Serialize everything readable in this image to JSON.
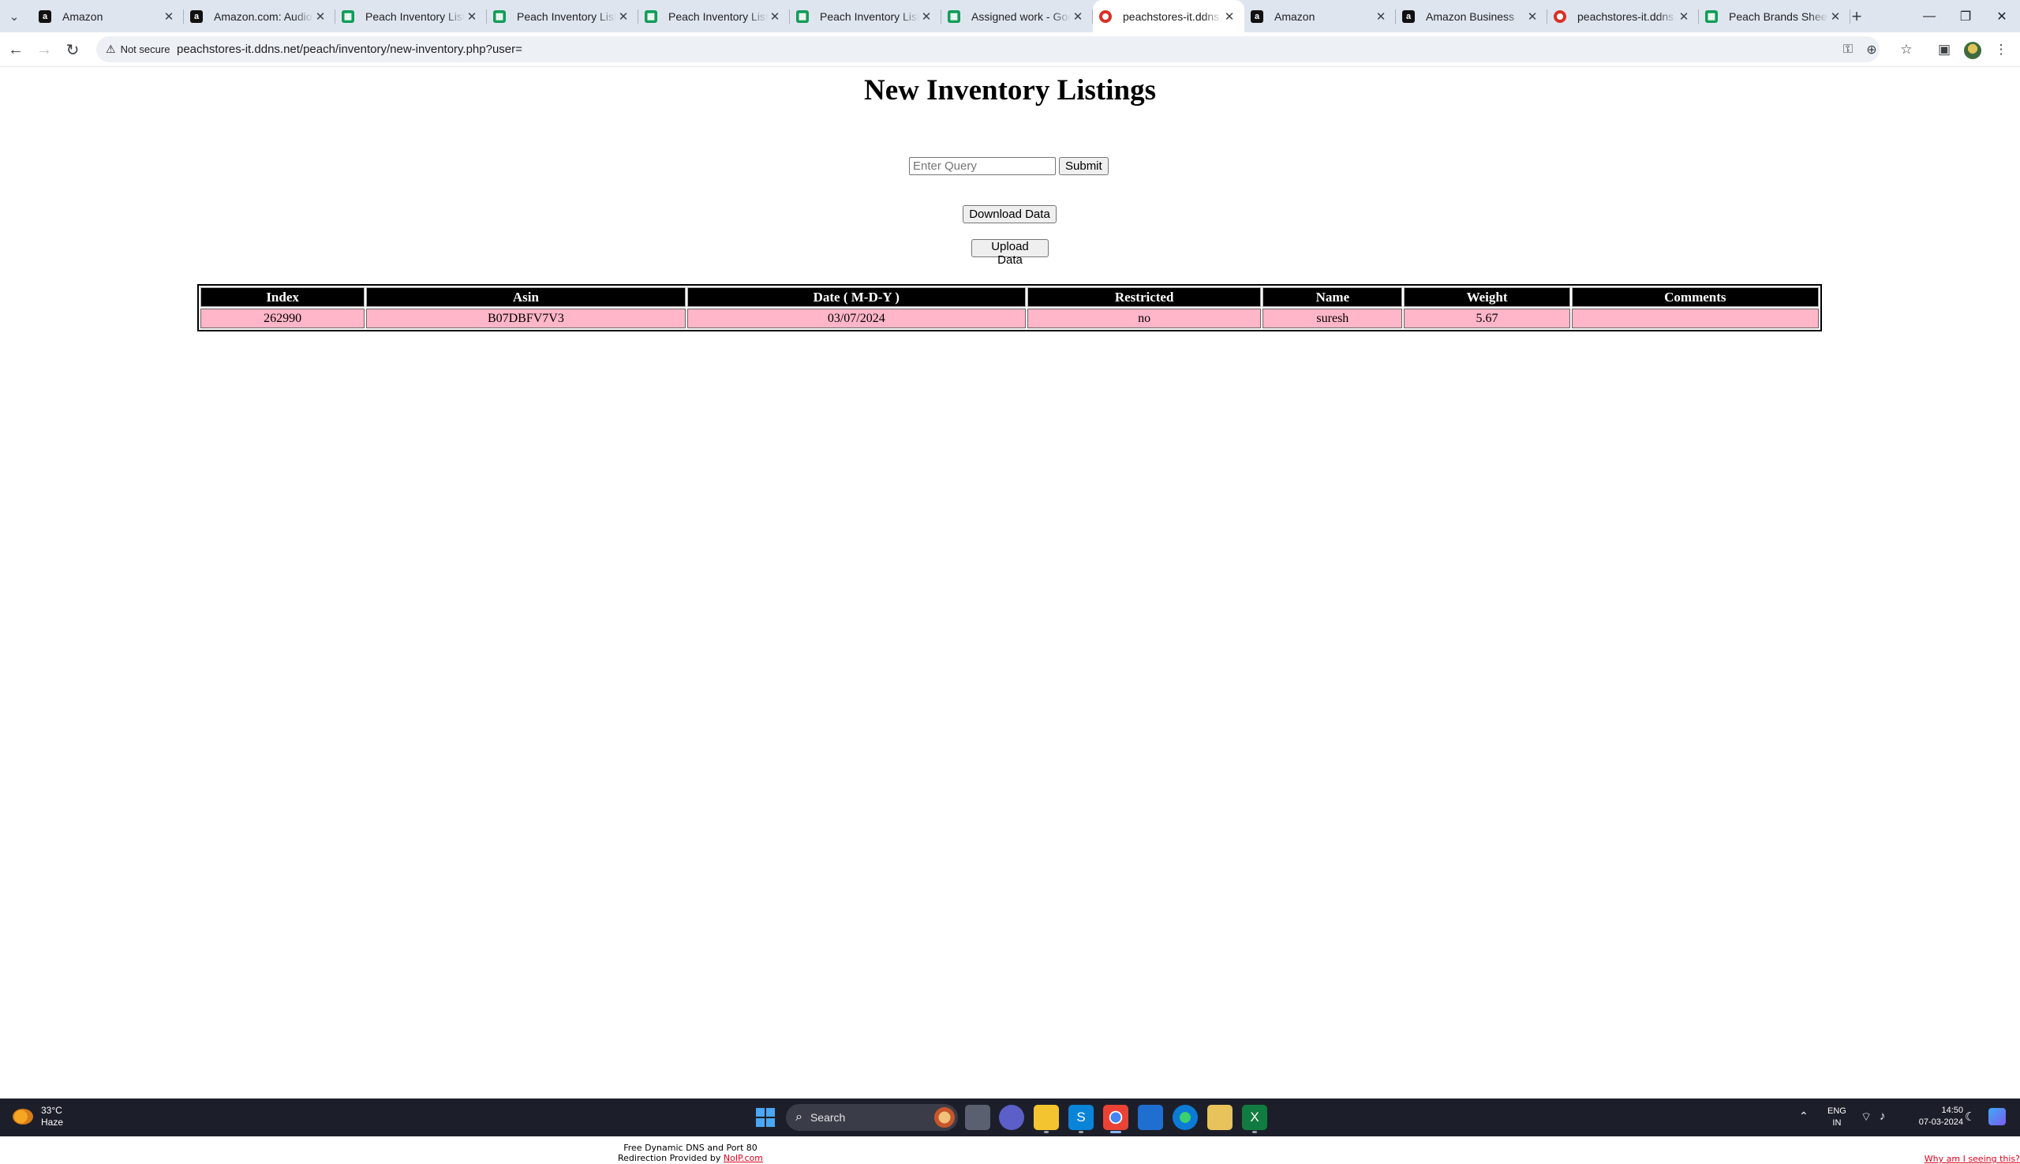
{
  "browser": {
    "tabs": [
      {
        "title": "Amazon",
        "favicon": "amazon-icon",
        "active": false
      },
      {
        "title": "Amazon.com: Audio-Technica",
        "favicon": "amazon-icon",
        "active": false
      },
      {
        "title": "Peach Inventory Listings",
        "favicon": "sheets-icon",
        "active": false
      },
      {
        "title": "Peach Inventory Listings",
        "favicon": "sheets-icon",
        "active": false
      },
      {
        "title": "Peach Inventory Listings",
        "favicon": "sheets-icon",
        "active": false
      },
      {
        "title": "Peach Inventory Listings",
        "favicon": "sheets-icon",
        "active": false
      },
      {
        "title": "Assigned work - Google",
        "favicon": "sheets-icon",
        "active": false
      },
      {
        "title": "peachstores-it.ddns.net",
        "favicon": "site-icon",
        "active": true
      },
      {
        "title": "Amazon",
        "favicon": "amazon-icon",
        "active": false
      },
      {
        "title": "Amazon Business",
        "favicon": "amazon-icon",
        "active": false
      },
      {
        "title": "peachstores-it.ddns.net",
        "favicon": "site-icon",
        "active": false
      },
      {
        "title": "Peach Brands Sheet - Google",
        "favicon": "sheets-icon",
        "active": false
      }
    ],
    "security_label": "Not secure",
    "url": "peachstores-it.ddns.net/peach/inventory/new-inventory.php?user="
  },
  "page": {
    "title": "New Inventory Listings",
    "query": {
      "placeholder": "Enter Query",
      "value": ""
    },
    "submit_label": "Submit",
    "download_label": "Download Data",
    "upload_label": "Upload Data",
    "table": {
      "headers": [
        "Index",
        "Asin",
        "Date ( M-D-Y )",
        "Restricted",
        "Name",
        "Weight",
        "Comments"
      ],
      "rows": [
        [
          "262990",
          "B07DBFV7V3",
          "03/07/2024",
          "no",
          "suresh",
          "5.67",
          ""
        ]
      ]
    },
    "footer": {
      "line1": "Free Dynamic DNS and Port 80",
      "line2_prefix": "Redirection Provided by ",
      "line2_link": "NoIP.com",
      "why_link": "Why am I seeing this?"
    }
  },
  "taskbar": {
    "weather_temp": "33°C",
    "weather_desc": "Haze",
    "search_label": "Search",
    "lang_top": "ENG",
    "lang_bottom": "IN",
    "time": "14:50",
    "date": "07-03-2024"
  }
}
